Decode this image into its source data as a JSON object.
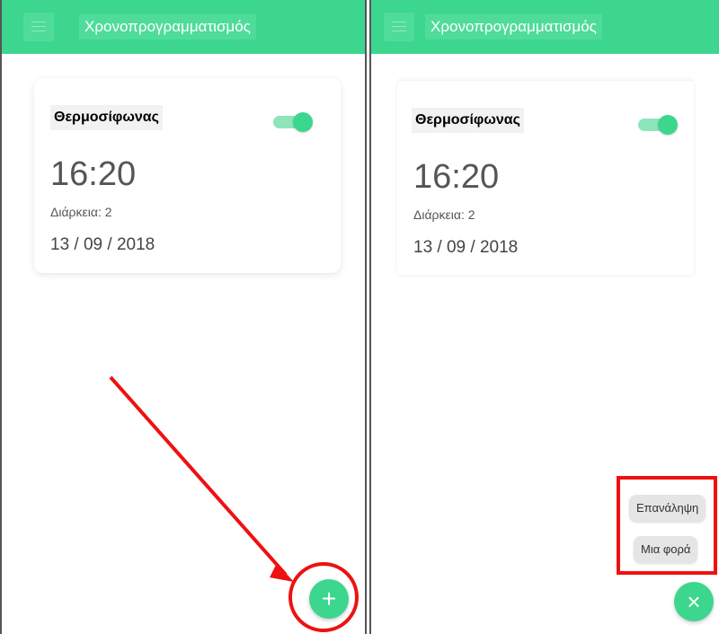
{
  "app": {
    "title": "Χρονοπρογραμματισμός",
    "accent_color": "#3dd68f"
  },
  "schedule_card": {
    "device": "Θερμοσίφωνας",
    "enabled": true,
    "time": "16:20",
    "duration": "Διάρκεια: 2",
    "date": "13 / 09 / 2018"
  },
  "left_screen": {
    "fab_icon": "plus-icon",
    "fab_symbol": "+"
  },
  "right_screen": {
    "options": [
      "Επανάληψη",
      "Μια φορά"
    ],
    "fab_icon": "close-icon",
    "fab_symbol": "×"
  },
  "annotation": {
    "color": "#ee1111",
    "items": [
      "arrow",
      "circle",
      "rectangle"
    ]
  }
}
